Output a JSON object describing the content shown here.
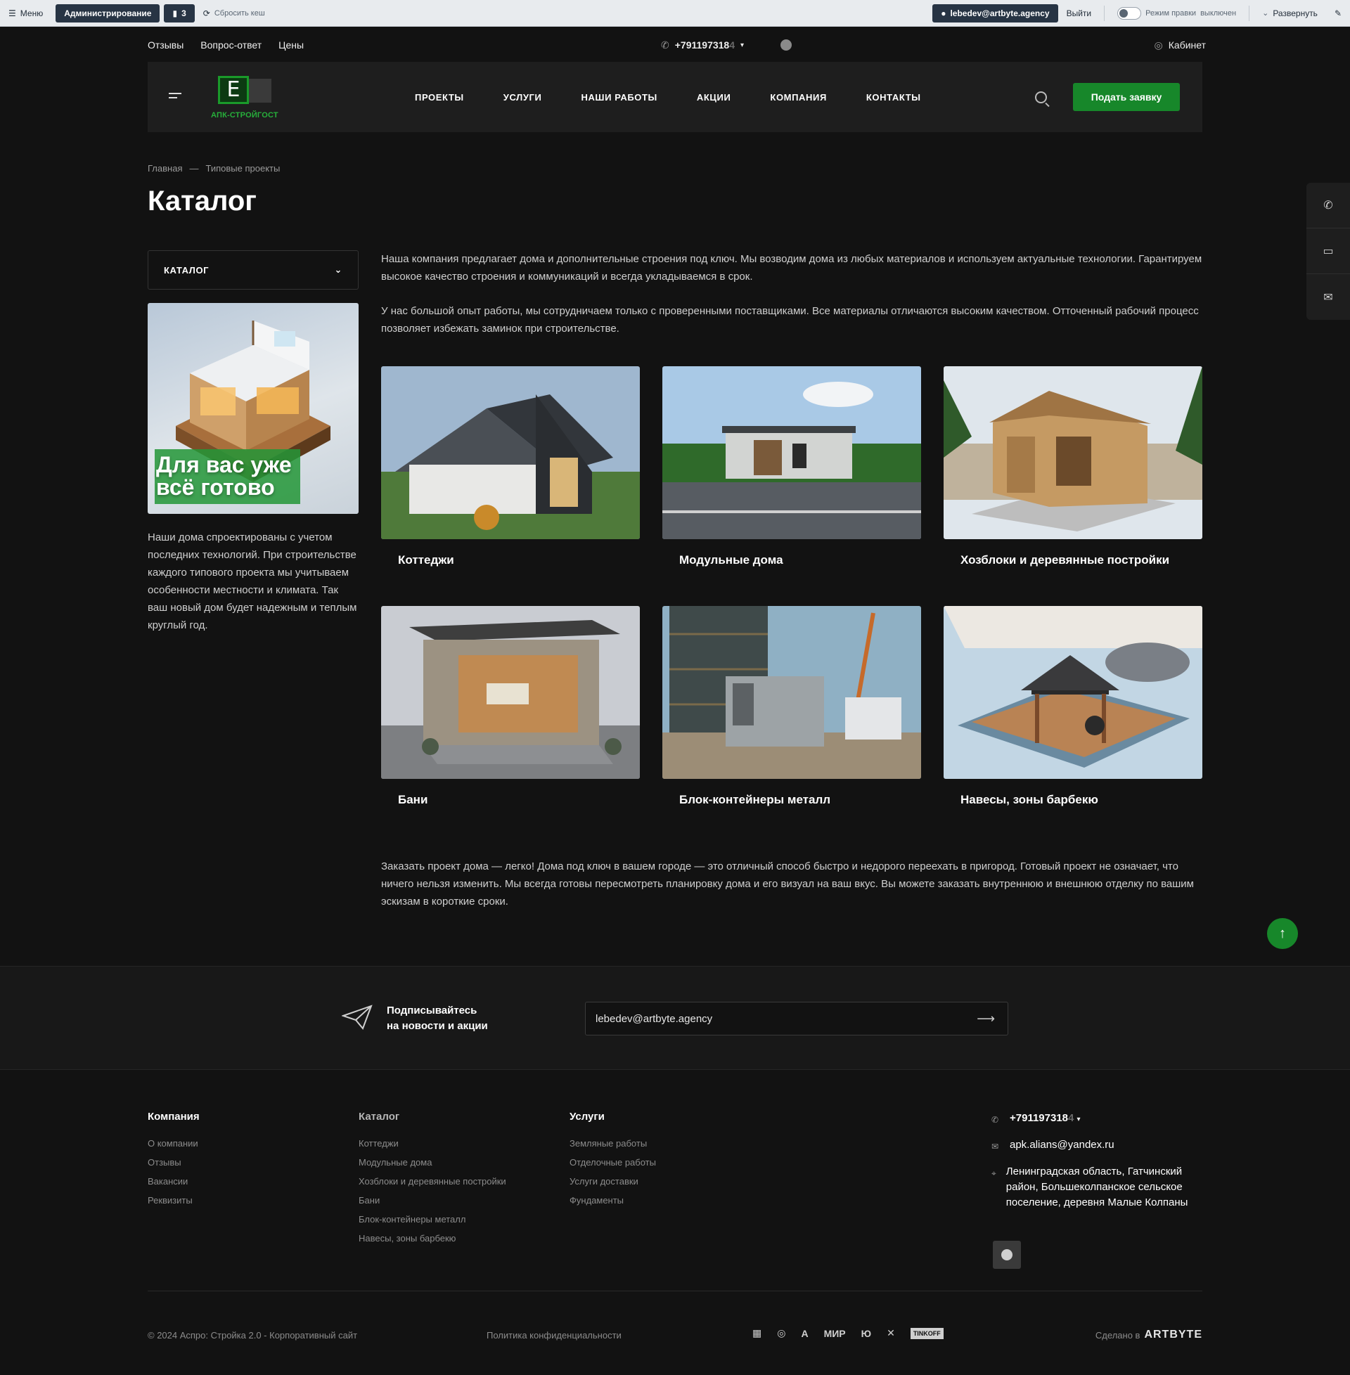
{
  "adminbar": {
    "menu": "Меню",
    "admin": "Администрирование",
    "counter": "3",
    "cache": "Сбросить кеш",
    "user": "lebedev@artbyte.agency",
    "logout": "Выйти",
    "edit_mode_label": "Режим правки",
    "edit_mode_state": "выключен",
    "expand": "Развернуть"
  },
  "topline": {
    "links": [
      "Отзывы",
      "Вопрос-ответ",
      "Цены"
    ],
    "phone_visible": "+791197318",
    "phone_faded": "4",
    "cabinet": "Кабинет"
  },
  "header": {
    "logo_letter": "E",
    "logo_text": "АПК-СТРОЙГОСТ",
    "nav": [
      "ПРОЕКТЫ",
      "УСЛУГИ",
      "НАШИ РАБОТЫ",
      "АКЦИИ",
      "КОМПАНИЯ",
      "КОНТАКТЫ"
    ],
    "cta": "Подать заявку"
  },
  "breadcrumbs": [
    "Главная",
    "—",
    "Типовые проекты"
  ],
  "page_title": "Каталог",
  "sidebar": {
    "select_label": "КАТАЛОГ",
    "banner_slogan_1": "Для вас уже",
    "banner_slogan_2": "всё готово",
    "text": "Наши дома спроектированы с учетом последних технологий. При строительстве каждого типового проекта мы учитываем особенности местности и климата. Так ваш новый дом будет надежным и теплым круглый год."
  },
  "intro": [
    "Наша компания предлагает дома и дополнительные строения под ключ. Мы возводим дома из любых материалов и используем актуальные технологии. Гарантируем высокое качество строения и коммуникаций и всегда укладываемся в срок.",
    "У нас большой опыт работы, мы сотрудничаем только с проверенными поставщиками. Все материалы отличаются высоким качеством. Отточенный рабочий процесс позволяет избежать заминок при строительстве."
  ],
  "catalog": [
    "Коттеджи",
    "Модульные дома",
    "Хозблоки и деревянные постройки",
    "Бани",
    "Блок-контейнеры металл",
    "Навесы, зоны барбекю"
  ],
  "outro": "Заказать проект дома — легко! Дома под ключ в вашем городе — это отличный способ быстро и недорого переехать в пригород. Готовый проект не означает, что ничего нельзя изменить. Мы всегда готовы пересмотреть планировку дома и его визуал на ваш вкус. Вы можете заказать внутреннюю и внешнюю отделку по вашим эскизам в короткие сроки.",
  "subscribe": {
    "line1": "Подписывайтесь",
    "line2": "на новости и акции",
    "value": "lebedev@artbyte.agency"
  },
  "footer": {
    "company_title": "Компания",
    "company": [
      "О компании",
      "Отзывы",
      "Вакансии",
      "Реквизиты"
    ],
    "catalog_title": "Каталог",
    "catalog": [
      "Коттеджи",
      "Модульные дома",
      "Хозблоки и деревянные постройки",
      "Бани",
      "Блок-контейнеры металл",
      "Навесы, зоны барбекю"
    ],
    "services_title": "Услуги",
    "services": [
      "Земляные работы",
      "Отделочные работы",
      "Услуги доставки",
      "Фундаменты"
    ],
    "phone_visible": "+791197318",
    "phone_faded": "4",
    "email": "apk.alians@yandex.ru",
    "address": "Ленинградская область, Гатчинский район, Большеколпанское сельское поселение, деревня Малые Колпаны",
    "copyright": "© 2024 Аспро: Стройка 2.0 - Корпоративный сайт",
    "policy": "Политика конфиденциальности",
    "pay_mir": "МИР",
    "pay_tinkoff": "TINKOFF",
    "made_in": "Сделано в",
    "made_brand": "ARTBYTE"
  }
}
